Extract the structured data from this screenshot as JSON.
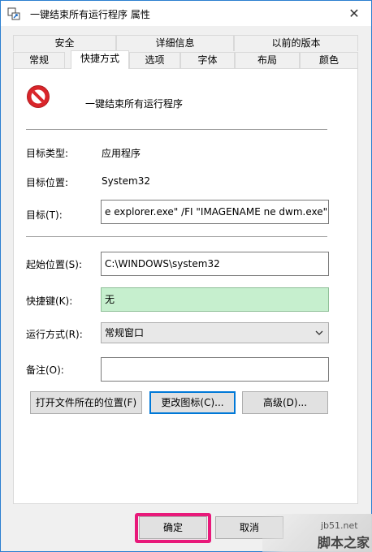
{
  "title": "一键结束所有运行程序 属性",
  "tabs_row1": [
    "安全",
    "详细信息",
    "以前的版本"
  ],
  "tabs_row2": [
    "常规",
    "快捷方式",
    "选项",
    "字体",
    "布局",
    "颜色"
  ],
  "app_name": "一键结束所有运行程序",
  "fields": {
    "target_type_label": "目标类型:",
    "target_type_value": "应用程序",
    "target_location_label": "目标位置:",
    "target_location_value": "System32",
    "target_label": "目标(T):",
    "target_value": "e explorer.exe\" /FI \"IMAGENAME ne dwm.exe\"",
    "start_in_label": "起始位置(S):",
    "start_in_value": "C:\\WINDOWS\\system32",
    "shortcut_key_label": "快捷键(K):",
    "shortcut_key_value": "无",
    "run_label": "运行方式(R):",
    "run_value": "常规窗口",
    "comment_label": "备注(O):",
    "comment_value": ""
  },
  "buttons": {
    "open_location": "打开文件所在的位置(F)",
    "change_icon": "更改图标(C)...",
    "advanced": "高级(D)...",
    "ok": "确定",
    "cancel": "取消"
  },
  "watermark": {
    "line1": "jb51.net",
    "line2": "脚本之家"
  },
  "colors": {
    "shortcut_key_bg": "#c6efce",
    "highlight": "#e8197a",
    "panel_bg": "#ffffff",
    "window_bg": "#f0f0f0"
  }
}
